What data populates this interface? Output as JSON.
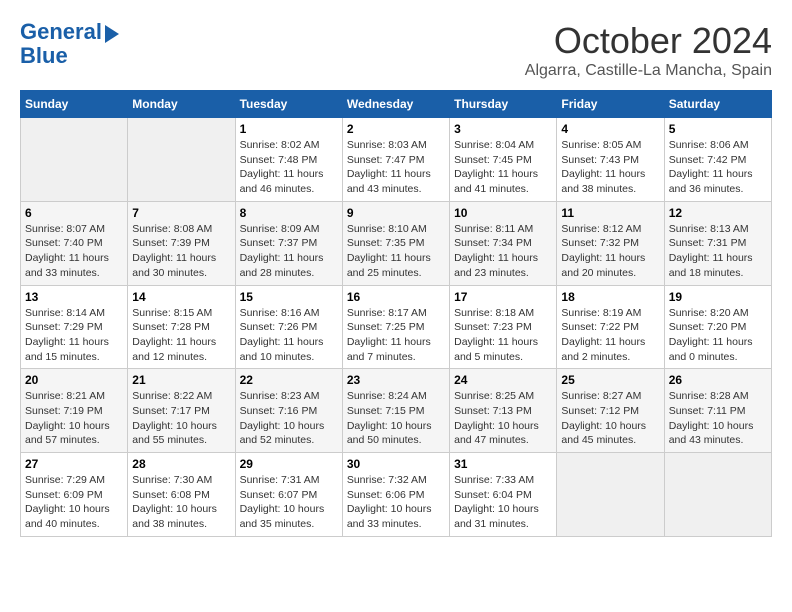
{
  "logo": {
    "line1": "General",
    "line2": "Blue"
  },
  "title": "October 2024",
  "subtitle": "Algarra, Castille-La Mancha, Spain",
  "days_of_week": [
    "Sunday",
    "Monday",
    "Tuesday",
    "Wednesday",
    "Thursday",
    "Friday",
    "Saturday"
  ],
  "weeks": [
    [
      {
        "day": "",
        "info": ""
      },
      {
        "day": "",
        "info": ""
      },
      {
        "day": "1",
        "info": "Sunrise: 8:02 AM\nSunset: 7:48 PM\nDaylight: 11 hours and 46 minutes."
      },
      {
        "day": "2",
        "info": "Sunrise: 8:03 AM\nSunset: 7:47 PM\nDaylight: 11 hours and 43 minutes."
      },
      {
        "day": "3",
        "info": "Sunrise: 8:04 AM\nSunset: 7:45 PM\nDaylight: 11 hours and 41 minutes."
      },
      {
        "day": "4",
        "info": "Sunrise: 8:05 AM\nSunset: 7:43 PM\nDaylight: 11 hours and 38 minutes."
      },
      {
        "day": "5",
        "info": "Sunrise: 8:06 AM\nSunset: 7:42 PM\nDaylight: 11 hours and 36 minutes."
      }
    ],
    [
      {
        "day": "6",
        "info": "Sunrise: 8:07 AM\nSunset: 7:40 PM\nDaylight: 11 hours and 33 minutes."
      },
      {
        "day": "7",
        "info": "Sunrise: 8:08 AM\nSunset: 7:39 PM\nDaylight: 11 hours and 30 minutes."
      },
      {
        "day": "8",
        "info": "Sunrise: 8:09 AM\nSunset: 7:37 PM\nDaylight: 11 hours and 28 minutes."
      },
      {
        "day": "9",
        "info": "Sunrise: 8:10 AM\nSunset: 7:35 PM\nDaylight: 11 hours and 25 minutes."
      },
      {
        "day": "10",
        "info": "Sunrise: 8:11 AM\nSunset: 7:34 PM\nDaylight: 11 hours and 23 minutes."
      },
      {
        "day": "11",
        "info": "Sunrise: 8:12 AM\nSunset: 7:32 PM\nDaylight: 11 hours and 20 minutes."
      },
      {
        "day": "12",
        "info": "Sunrise: 8:13 AM\nSunset: 7:31 PM\nDaylight: 11 hours and 18 minutes."
      }
    ],
    [
      {
        "day": "13",
        "info": "Sunrise: 8:14 AM\nSunset: 7:29 PM\nDaylight: 11 hours and 15 minutes."
      },
      {
        "day": "14",
        "info": "Sunrise: 8:15 AM\nSunset: 7:28 PM\nDaylight: 11 hours and 12 minutes."
      },
      {
        "day": "15",
        "info": "Sunrise: 8:16 AM\nSunset: 7:26 PM\nDaylight: 11 hours and 10 minutes."
      },
      {
        "day": "16",
        "info": "Sunrise: 8:17 AM\nSunset: 7:25 PM\nDaylight: 11 hours and 7 minutes."
      },
      {
        "day": "17",
        "info": "Sunrise: 8:18 AM\nSunset: 7:23 PM\nDaylight: 11 hours and 5 minutes."
      },
      {
        "day": "18",
        "info": "Sunrise: 8:19 AM\nSunset: 7:22 PM\nDaylight: 11 hours and 2 minutes."
      },
      {
        "day": "19",
        "info": "Sunrise: 8:20 AM\nSunset: 7:20 PM\nDaylight: 11 hours and 0 minutes."
      }
    ],
    [
      {
        "day": "20",
        "info": "Sunrise: 8:21 AM\nSunset: 7:19 PM\nDaylight: 10 hours and 57 minutes."
      },
      {
        "day": "21",
        "info": "Sunrise: 8:22 AM\nSunset: 7:17 PM\nDaylight: 10 hours and 55 minutes."
      },
      {
        "day": "22",
        "info": "Sunrise: 8:23 AM\nSunset: 7:16 PM\nDaylight: 10 hours and 52 minutes."
      },
      {
        "day": "23",
        "info": "Sunrise: 8:24 AM\nSunset: 7:15 PM\nDaylight: 10 hours and 50 minutes."
      },
      {
        "day": "24",
        "info": "Sunrise: 8:25 AM\nSunset: 7:13 PM\nDaylight: 10 hours and 47 minutes."
      },
      {
        "day": "25",
        "info": "Sunrise: 8:27 AM\nSunset: 7:12 PM\nDaylight: 10 hours and 45 minutes."
      },
      {
        "day": "26",
        "info": "Sunrise: 8:28 AM\nSunset: 7:11 PM\nDaylight: 10 hours and 43 minutes."
      }
    ],
    [
      {
        "day": "27",
        "info": "Sunrise: 7:29 AM\nSunset: 6:09 PM\nDaylight: 10 hours and 40 minutes."
      },
      {
        "day": "28",
        "info": "Sunrise: 7:30 AM\nSunset: 6:08 PM\nDaylight: 10 hours and 38 minutes."
      },
      {
        "day": "29",
        "info": "Sunrise: 7:31 AM\nSunset: 6:07 PM\nDaylight: 10 hours and 35 minutes."
      },
      {
        "day": "30",
        "info": "Sunrise: 7:32 AM\nSunset: 6:06 PM\nDaylight: 10 hours and 33 minutes."
      },
      {
        "day": "31",
        "info": "Sunrise: 7:33 AM\nSunset: 6:04 PM\nDaylight: 10 hours and 31 minutes."
      },
      {
        "day": "",
        "info": ""
      },
      {
        "day": "",
        "info": ""
      }
    ]
  ]
}
